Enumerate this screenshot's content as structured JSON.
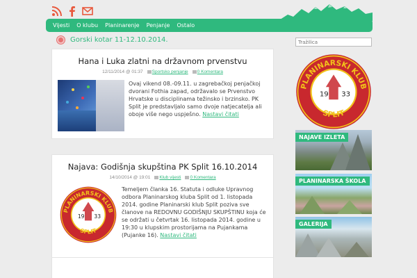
{
  "header": {
    "icons": [
      "rss-icon",
      "facebook-icon",
      "email-icon"
    ]
  },
  "nav": {
    "items": [
      "Vijesti",
      "O klubu",
      "Planinarenje",
      "Penjanje",
      "Ostalo"
    ]
  },
  "category": {
    "title": "Gorski kotar 11-12.10.2014."
  },
  "posts": [
    {
      "title": "Hana i Luka zlatni na državnom prvenstvu",
      "date": "12/11/2014 @ 01:37",
      "category": "Sportsko penjanje",
      "comments": "0 Komentara",
      "excerpt": "Ovaj vikend 08.-09.11. u zagrebačkoj penjačkoj dvorani Fothia zapad, održavalo se Prvenstvo Hrvatske u disciplinama težinsko i brzinsko. PK Split je predstavljalo samo dvoje natjecatelja ali oboje više nego uspješno.",
      "more": "Nastavi čitati"
    },
    {
      "title": "Najava: Godišnja skupština PK Split 16.10.2014",
      "date": "14/10/2014 @ 19:01",
      "category": "Klub vijesti",
      "comments": "0 Komentara",
      "excerpt": "Temeljem članka 16. Statuta i odluke Upravnog odbora Planinarskog kluba Split od 1. listopada 2014. godine Planinarski klub Split poziva sve članove na REDOVNU GODIŠNJU SKUPŠTINU koja će se održati u četvrtak 16. listopada 2014. godine u 19:30 u klupskim prostorijama na Pujankama (Pujanke 16).",
      "more": "Nastavi čitati"
    }
  ],
  "sidebar": {
    "search_placeholder": "Tražilica",
    "logo_text_top": "PLANINARSKI KLUB",
    "logo_text_bottom": "SPLIT",
    "logo_year_left": "19",
    "logo_year_right": "33",
    "tiles": [
      "NAJAVE IZLETA",
      "PLANINARSKA ŠKOLA",
      "GALERIJA"
    ]
  },
  "colors": {
    "accent": "#2fb97e",
    "logo_red": "#c8282e",
    "logo_yellow": "#f2c21a"
  }
}
